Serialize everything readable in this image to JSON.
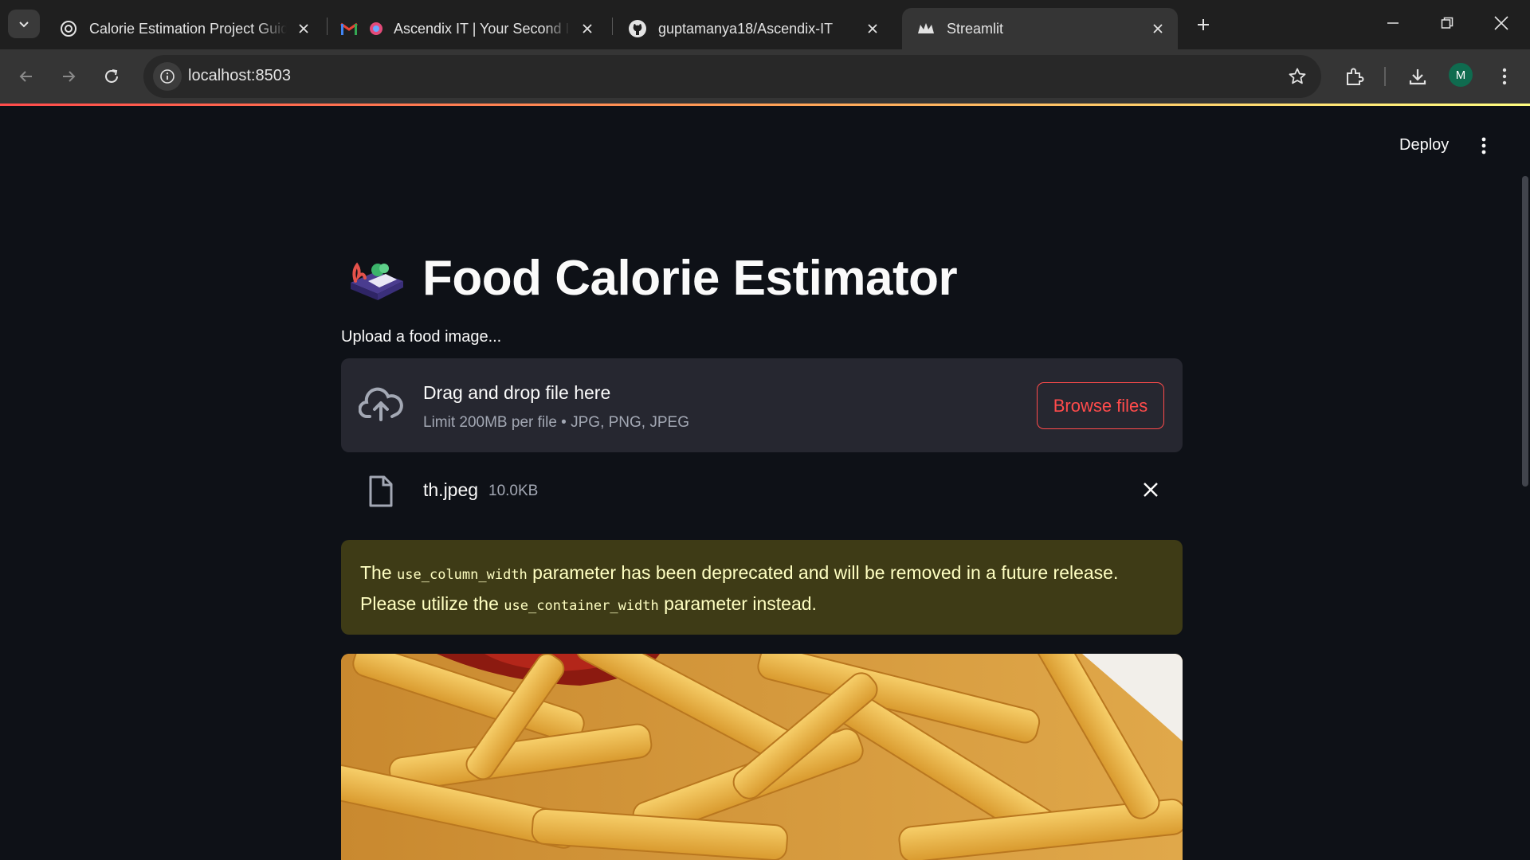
{
  "browser": {
    "tabs": [
      {
        "title": "Calorie Estimation Project Guide",
        "favicon": "openai-icon"
      },
      {
        "title": "Ascendix IT | Your Second In",
        "favicon": "gmail-icon"
      },
      {
        "title": "guptamanya18/Ascendix-IT",
        "favicon": "github-icon"
      },
      {
        "title": "Streamlit",
        "favicon": "streamlit-icon",
        "active": true
      }
    ],
    "url": "localhost:8503",
    "profile_initial": "M"
  },
  "app": {
    "deploy_label": "Deploy",
    "title": "Food Calorie Estimator",
    "title_emoji": "bento-box-emoji",
    "uploader": {
      "label": "Upload a food image...",
      "drag_text": "Drag and drop file here",
      "limit_text": "Limit 200MB per file • JPG, PNG, JPEG",
      "browse_label": "Browse files"
    },
    "uploaded_file": {
      "name": "th.jpeg",
      "size": "10.0KB"
    },
    "warning": {
      "part1": "The ",
      "code1": "use_column_width",
      "part2": " parameter has been deprecated and will be removed in a future release. Please utilize the ",
      "code2": "use_container_width",
      "part3": " parameter instead."
    },
    "image_subject": "french-fries"
  },
  "colors": {
    "app_bg": "#0e1117",
    "accent": "#ff4b4b",
    "dropzone_bg": "#262730",
    "warning_bg": "#3e3b16",
    "warning_text": "#ffffc2"
  }
}
